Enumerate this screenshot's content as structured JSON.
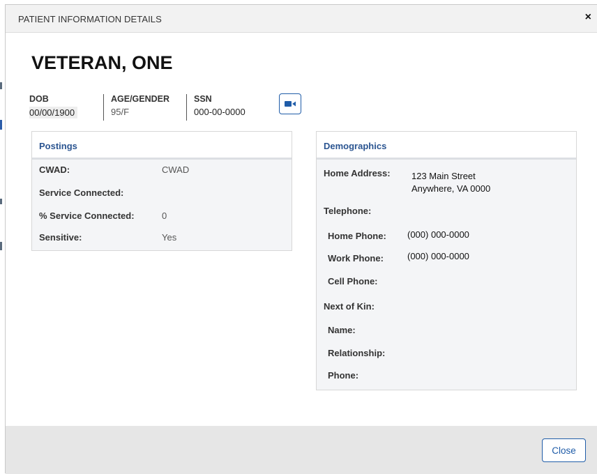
{
  "modal": {
    "title": "PATIENT INFORMATION DETAILS",
    "close_symbol": "×"
  },
  "patient": {
    "name": "VETERAN, ONE",
    "dob_label": "DOB",
    "dob": "00/00/1900",
    "age_gender_label": "AGE/GENDER",
    "age_gender": "95/F",
    "ssn_label": "SSN",
    "ssn": "000-00-0000",
    "video_icon": "video-camera-icon"
  },
  "postings": {
    "title": "Postings",
    "rows": [
      {
        "label": "CWAD:",
        "value": "CWAD"
      },
      {
        "label": "Service Connected:",
        "value": ""
      },
      {
        "label": "% Service Connected:",
        "value": "0"
      },
      {
        "label": "Sensitive:",
        "value": "Yes"
      }
    ]
  },
  "demographics": {
    "title": "Demographics",
    "home_address_label": "Home Address:",
    "home_address_line1": "123 Main Street",
    "home_address_line2": "Anywhere, VA 0000",
    "telephone_label": "Telephone:",
    "home_phone_label": "Home Phone:",
    "home_phone": "(000) 000-0000",
    "work_phone_label": "Work Phone:",
    "work_phone": "(000) 000-0000",
    "cell_phone_label": "Cell Phone:",
    "cell_phone": "",
    "next_of_kin_label": "Next of Kin:",
    "nok_name_label": "Name:",
    "nok_relationship_label": "Relationship:",
    "nok_phone_label": "Phone:"
  },
  "footer": {
    "close_label": "Close"
  },
  "colors": {
    "accent": "#1f5ca8",
    "section_title": "#2b5591",
    "header_bg": "#f2f2f2",
    "footer_bg": "#e6e6e6"
  }
}
